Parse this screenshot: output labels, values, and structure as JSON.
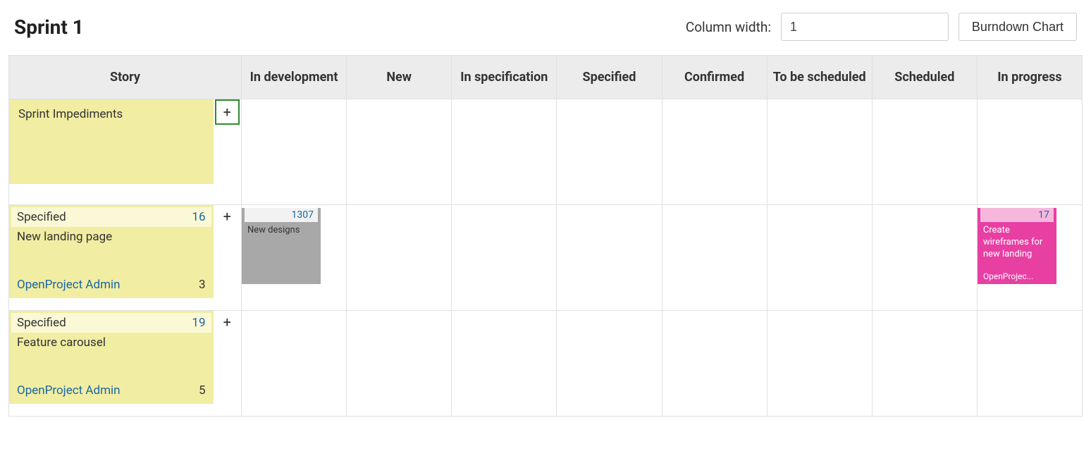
{
  "header": {
    "title": "Sprint 1",
    "column_width_label": "Column width:",
    "column_width_value": "1",
    "burndown_label": "Burndown Chart"
  },
  "columns": {
    "story": "Story",
    "in_development": "In development",
    "new": "New",
    "in_specification": "In specification",
    "specified": "Specified",
    "confirmed": "Confirmed",
    "to_be_scheduled": "To be scheduled",
    "scheduled": "Scheduled",
    "in_progress": "In progress"
  },
  "add_label": "+",
  "rows": [
    {
      "story": {
        "kind": "simple",
        "title": "Sprint Impediments"
      },
      "add_highlight": true,
      "tasks": {}
    },
    {
      "story": {
        "kind": "full",
        "status": "Specified",
        "id": "16",
        "title": "New landing page",
        "owner": "OpenProject Admin",
        "points": "3"
      },
      "add_highlight": false,
      "tasks": {
        "in_development": {
          "color": "grey",
          "id": "1307",
          "title": "New designs"
        },
        "in_progress": {
          "color": "pink",
          "id": "17",
          "title": "Create wireframes for new landing",
          "owner": "OpenProjec..."
        }
      }
    },
    {
      "story": {
        "kind": "full",
        "status": "Specified",
        "id": "19",
        "title": "Feature carousel",
        "owner": "OpenProject Admin",
        "points": "5"
      },
      "add_highlight": false,
      "tasks": {}
    }
  ]
}
